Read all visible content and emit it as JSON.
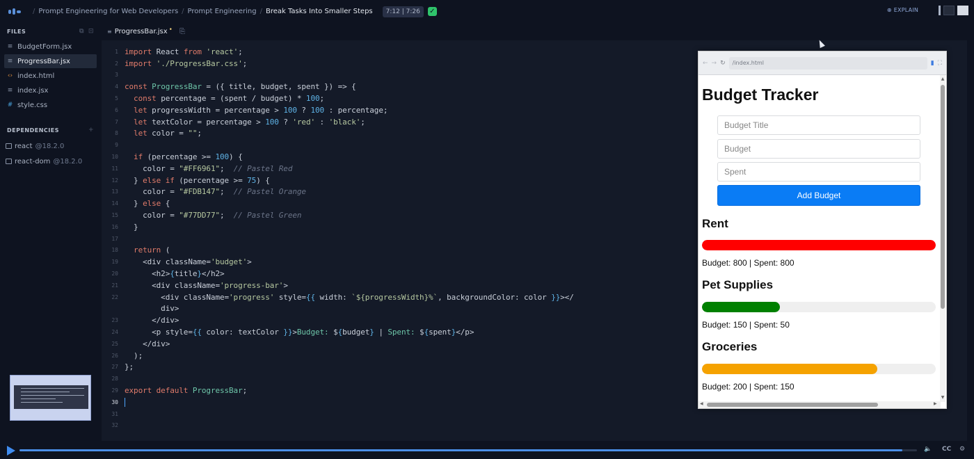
{
  "breadcrumb": {
    "course": "Prompt Engineering for Web Developers",
    "section": "Prompt Engineering",
    "lesson": "Break Tasks Into Smaller Steps",
    "time": "7:12 | 7:26"
  },
  "header": {
    "explain_label": "EXPLAIN"
  },
  "sidebar": {
    "files_heading": "FILES",
    "files": [
      {
        "name": "BudgetForm.jsx",
        "icon": "jsx-file-icon"
      },
      {
        "name": "ProgressBar.jsx",
        "icon": "jsx-file-icon",
        "active": true
      },
      {
        "name": "index.html",
        "icon": "html-file-icon"
      },
      {
        "name": "index.jsx",
        "icon": "jsx-file-icon"
      },
      {
        "name": "style.css",
        "icon": "css-file-icon"
      }
    ],
    "dependencies_heading": "DEPENDENCIES",
    "dependencies": [
      {
        "name": "react",
        "version": "@18.2.0"
      },
      {
        "name": "react-dom",
        "version": "@18.2.0"
      }
    ]
  },
  "editor": {
    "tab_name": "ProgressBar.jsx",
    "tab_modified": "•",
    "current_line": "30",
    "line_numbers": [
      "1",
      "2",
      "3",
      "4",
      "5",
      "6",
      "7",
      "8",
      "9",
      "10",
      "11",
      "12",
      "13",
      "14",
      "15",
      "16",
      "17",
      "18",
      "19",
      "20",
      "21",
      "22",
      "",
      "23",
      "24",
      "25",
      "26",
      "27",
      "28",
      "29",
      "30",
      "31",
      "32"
    ]
  },
  "preview": {
    "url": "/index.html",
    "title": "Budget Tracker",
    "placeholders": {
      "title": "Budget Title",
      "budget": "Budget",
      "spent": "Spent"
    },
    "button_label": "Add Budget",
    "budgets": [
      {
        "title": "Rent",
        "info": "Budget: 800 | Spent: 800",
        "percent": 100,
        "color": "#ff0000"
      },
      {
        "title": "Pet Supplies",
        "info": "Budget: 150 | Spent: 50",
        "percent": 33.3,
        "color": "#008000"
      },
      {
        "title": "Groceries",
        "info": "Budget: 200 | Spent: 150",
        "percent": 75,
        "color": "#f5a200"
      }
    ]
  },
  "player": {
    "progress_percent": 98.4
  },
  "colors": {
    "accent": "#4b8fe8",
    "success": "#2fc46b",
    "editor_bg": "#141a28",
    "button_blue": "#0a7cf5"
  }
}
